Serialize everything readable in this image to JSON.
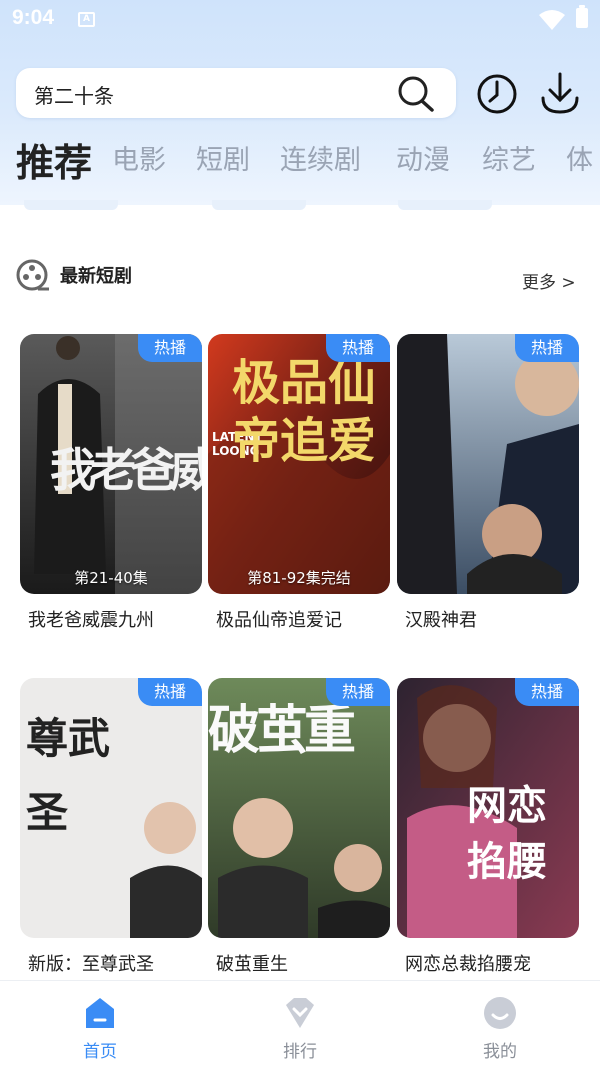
{
  "status": {
    "time": "9:04",
    "notification_glyph": "A"
  },
  "search": {
    "query": "第二十条"
  },
  "tabs": [
    {
      "label": "推荐",
      "active": true
    },
    {
      "label": "电影"
    },
    {
      "label": "短剧"
    },
    {
      "label": "连续剧"
    },
    {
      "label": "动漫"
    },
    {
      "label": "综艺"
    },
    {
      "label": "体"
    }
  ],
  "section": {
    "title": "最新短剧",
    "more": "更多 >"
  },
  "cards": [
    {
      "title": "我老爸威震九州",
      "badge": "热播",
      "episode": "第21-40集",
      "poster_text": "我老爸威震"
    },
    {
      "title": "极品仙帝追爱记",
      "badge": "热播",
      "episode": "第81-92集完结",
      "poster_text": "极品仙帝追爱",
      "poster_sub": "LATENT LOONG"
    },
    {
      "title": "汉殿神君",
      "badge": "热播",
      "episode": "",
      "poster_text": ""
    },
    {
      "title": "新版：至尊武圣",
      "badge": "热播",
      "episode": "",
      "poster_text": "尊武圣"
    },
    {
      "title": "破茧重生",
      "badge": "热播",
      "episode": "",
      "poster_text": "破茧重"
    },
    {
      "title": "网恋总裁掐腰宠",
      "badge": "热播",
      "episode": "",
      "poster_text": "网恋掐腰"
    }
  ],
  "nav": [
    {
      "label": "首页",
      "icon": "home-icon",
      "active": true
    },
    {
      "label": "排行",
      "icon": "ranking-icon"
    },
    {
      "label": "我的",
      "icon": "profile-icon"
    }
  ],
  "colors": {
    "accent": "#3a8cf5",
    "header_bg": "#d4e6fb"
  }
}
